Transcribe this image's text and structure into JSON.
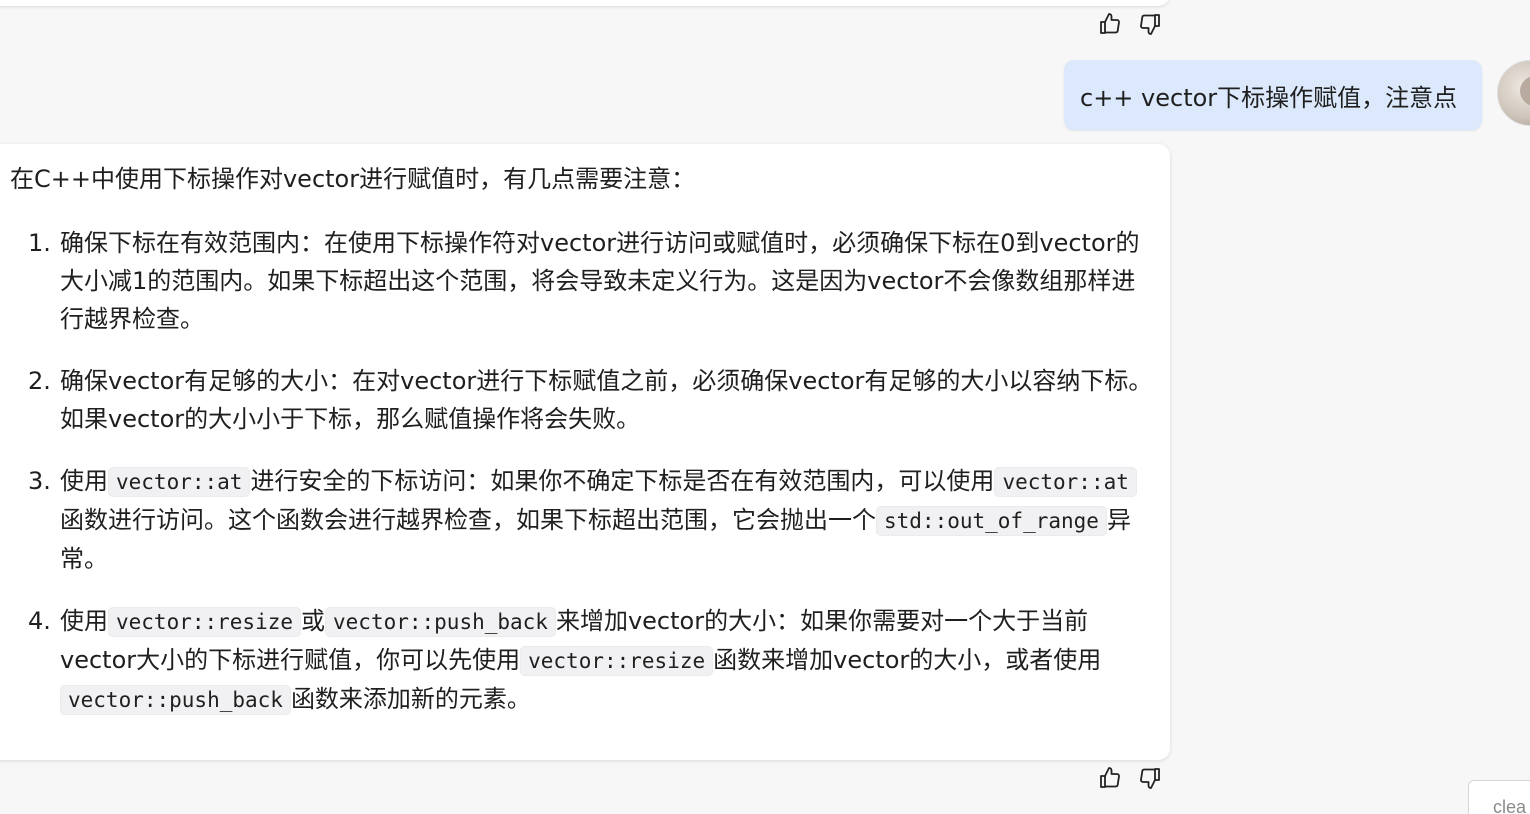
{
  "previous_feedback": {
    "like_icon": "thumbs-up-icon",
    "dislike_icon": "thumbs-down-icon"
  },
  "user_message": {
    "text": "c++ vector下标操作赋值，注意点"
  },
  "answer": {
    "intro": "在C++中使用下标操作对vector进行赋值时，有几点需要注意：",
    "items": [
      {
        "num": "1.",
        "segments": [
          {
            "type": "text",
            "value": "确保下标在有效范围内：在使用下标操作符对vector进行访问或赋值时，必须确保下标在0到vector的大小减1的范围内。如果下标超出这个范围，将会导致未定义行为。这是因为vector不会像数组那样进行越界检查。"
          }
        ]
      },
      {
        "num": "2.",
        "segments": [
          {
            "type": "text",
            "value": "确保vector有足够的大小：在对vector进行下标赋值之前，必须确保vector有足够的大小以容纳下标。如果vector的大小小于下标，那么赋值操作将会失败。"
          }
        ]
      },
      {
        "num": "3.",
        "segments": [
          {
            "type": "text",
            "value": "使用"
          },
          {
            "type": "code",
            "value": "vector::at"
          },
          {
            "type": "text",
            "value": "进行安全的下标访问：如果你不确定下标是否在有效范围内，可以使用"
          },
          {
            "type": "code",
            "value": "vector::at"
          },
          {
            "type": "text",
            "value": "函数进行访问。这个函数会进行越界检查，如果下标超出范围，它会抛出一个"
          },
          {
            "type": "code",
            "value": "std::out_of_range"
          },
          {
            "type": "text",
            "value": "异常。"
          }
        ]
      },
      {
        "num": "4.",
        "segments": [
          {
            "type": "text",
            "value": "使用"
          },
          {
            "type": "code",
            "value": "vector::resize"
          },
          {
            "type": "text",
            "value": "或"
          },
          {
            "type": "code",
            "value": "vector::push_back"
          },
          {
            "type": "text",
            "value": "来增加vector的大小：如果你需要对一个大于当前vector大小的下标进行赋值，你可以先使用"
          },
          {
            "type": "code",
            "value": "vector::resize"
          },
          {
            "type": "text",
            "value": "函数来增加vector的大小，或者使用"
          },
          {
            "type": "code",
            "value": "vector::push_back"
          },
          {
            "type": "text",
            "value": "函数来添加新的元素。"
          }
        ]
      }
    ]
  },
  "clear_chip": {
    "label": "clea"
  },
  "colors": {
    "user_bubble": "#dce9fc",
    "page_bg": "#f7f7f8",
    "card_bg": "#ffffff"
  }
}
